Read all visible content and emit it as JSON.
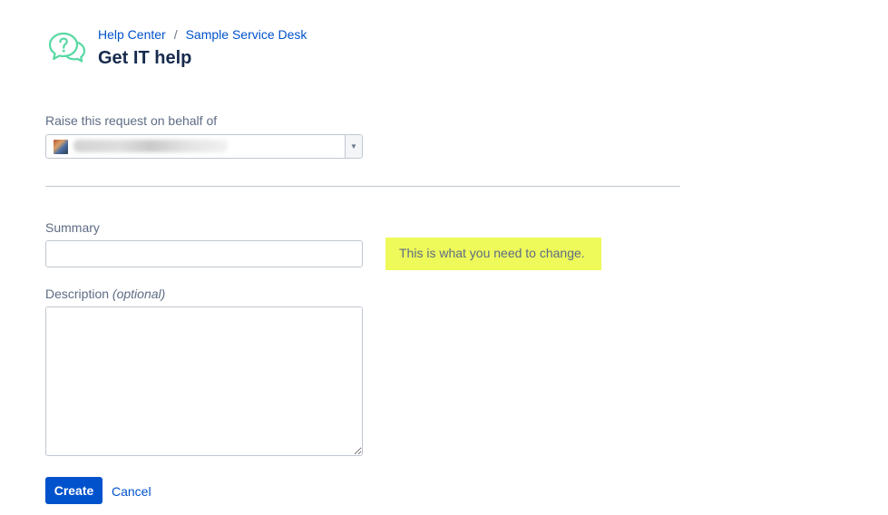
{
  "header": {
    "logo_icon": "help-chat-bubbles-icon",
    "breadcrumb": {
      "items": [
        "Help Center",
        "Sample Service Desk"
      ],
      "separator": "/"
    },
    "title": "Get IT help"
  },
  "form": {
    "behalf": {
      "label": "Raise this request on behalf of",
      "selected_value": "",
      "avatar_icon": "user-avatar",
      "dropdown_icon": "triangle-down-icon"
    },
    "summary": {
      "label": "Summary",
      "value": "",
      "placeholder": ""
    },
    "description": {
      "label": "Description",
      "optional_text": "(optional)",
      "value": ""
    },
    "actions": {
      "create_label": "Create",
      "cancel_label": "Cancel"
    }
  },
  "annotation": {
    "text": "This is what you need to change."
  },
  "colors": {
    "accent": "#0052cc",
    "logo": "#57d9a3",
    "highlight": "#eef95a",
    "text_muted": "#5e6c84",
    "border": "#c1c7d0"
  }
}
